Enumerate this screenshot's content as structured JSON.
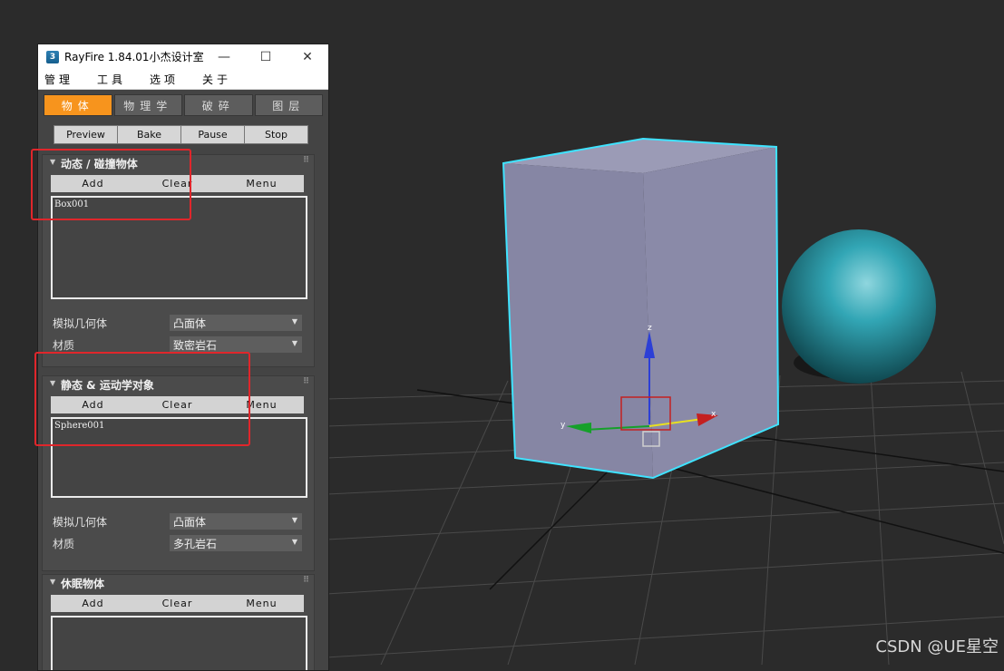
{
  "window": {
    "title": "RayFire 1.84.01小杰设计室",
    "app_icon_label": "3",
    "controls": {
      "minimize": "—",
      "maximize": "☐",
      "close": "✕"
    }
  },
  "menu": [
    "管理",
    "工具",
    "选项",
    "关于"
  ],
  "tabs": [
    {
      "label": "物体",
      "active": true
    },
    {
      "label": "物理学",
      "active": false
    },
    {
      "label": "破碎",
      "active": false
    },
    {
      "label": "图层",
      "active": false
    }
  ],
  "transport": [
    "Preview",
    "Bake",
    "Pause",
    "Stop"
  ],
  "rollouts": [
    {
      "title": "动态 / 碰撞物体",
      "buttons": [
        "Add",
        "Clear",
        "Menu"
      ],
      "items": [
        "Box001"
      ],
      "props": [
        {
          "label": "模拟几何体",
          "value": "凸面体"
        },
        {
          "label": "材质",
          "value": "致密岩石"
        }
      ]
    },
    {
      "title": "静态 & 运动学对象",
      "buttons": [
        "Add",
        "Clear",
        "Menu"
      ],
      "items": [
        "Sphere001"
      ],
      "props": [
        {
          "label": "模拟几何体",
          "value": "凸面体"
        },
        {
          "label": "材质",
          "value": "多孔岩石"
        }
      ]
    },
    {
      "title": "休眠物体",
      "buttons": [
        "Add",
        "Clear",
        "Menu"
      ],
      "items": [],
      "props": []
    }
  ],
  "viewport": {
    "gizmo_axes": {
      "x": "x",
      "y": "y",
      "z": "z"
    },
    "colors": {
      "box": "#8a8aa3",
      "selection": "#3fe3ff",
      "sphere": "#2aa3b3",
      "background": "#2b2b2b"
    }
  },
  "watermark": "CSDN @UE星空"
}
